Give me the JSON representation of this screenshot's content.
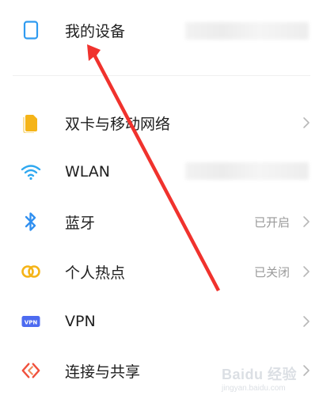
{
  "settings": {
    "items": [
      {
        "label": "我的设备",
        "status": "",
        "icon": "phone-device-icon",
        "blurred_value": true
      },
      {
        "label": "双卡与移动网络",
        "status": "",
        "icon": "sim-card-icon",
        "blurred_value": false
      },
      {
        "label": "WLAN",
        "status": "",
        "icon": "wifi-icon",
        "blurred_value": true
      },
      {
        "label": "蓝牙",
        "status": "已开启",
        "icon": "bluetooth-icon",
        "blurred_value": false
      },
      {
        "label": "个人热点",
        "status": "已关闭",
        "icon": "hotspot-icon",
        "blurred_value": false
      },
      {
        "label": "VPN",
        "status": "",
        "icon": "vpn-icon",
        "vpn_badge": "VPN",
        "blurred_value": false
      },
      {
        "label": "连接与共享",
        "status": "",
        "icon": "connection-sharing-icon",
        "blurred_value": false
      }
    ]
  },
  "colors": {
    "device_icon": "#2f9bf0",
    "sim_icon": "#f5b418",
    "wifi_icon": "#2fa8f0",
    "bluetooth_icon": "#2f8ff0",
    "hotspot_icon": "#f5b418",
    "vpn_icon": "#4d6bf0",
    "share_icon": "#f0503c",
    "arrow": "#f0322d"
  },
  "watermark": {
    "text": "Baidu 经验",
    "sub": "jingyan.baidu.com"
  }
}
